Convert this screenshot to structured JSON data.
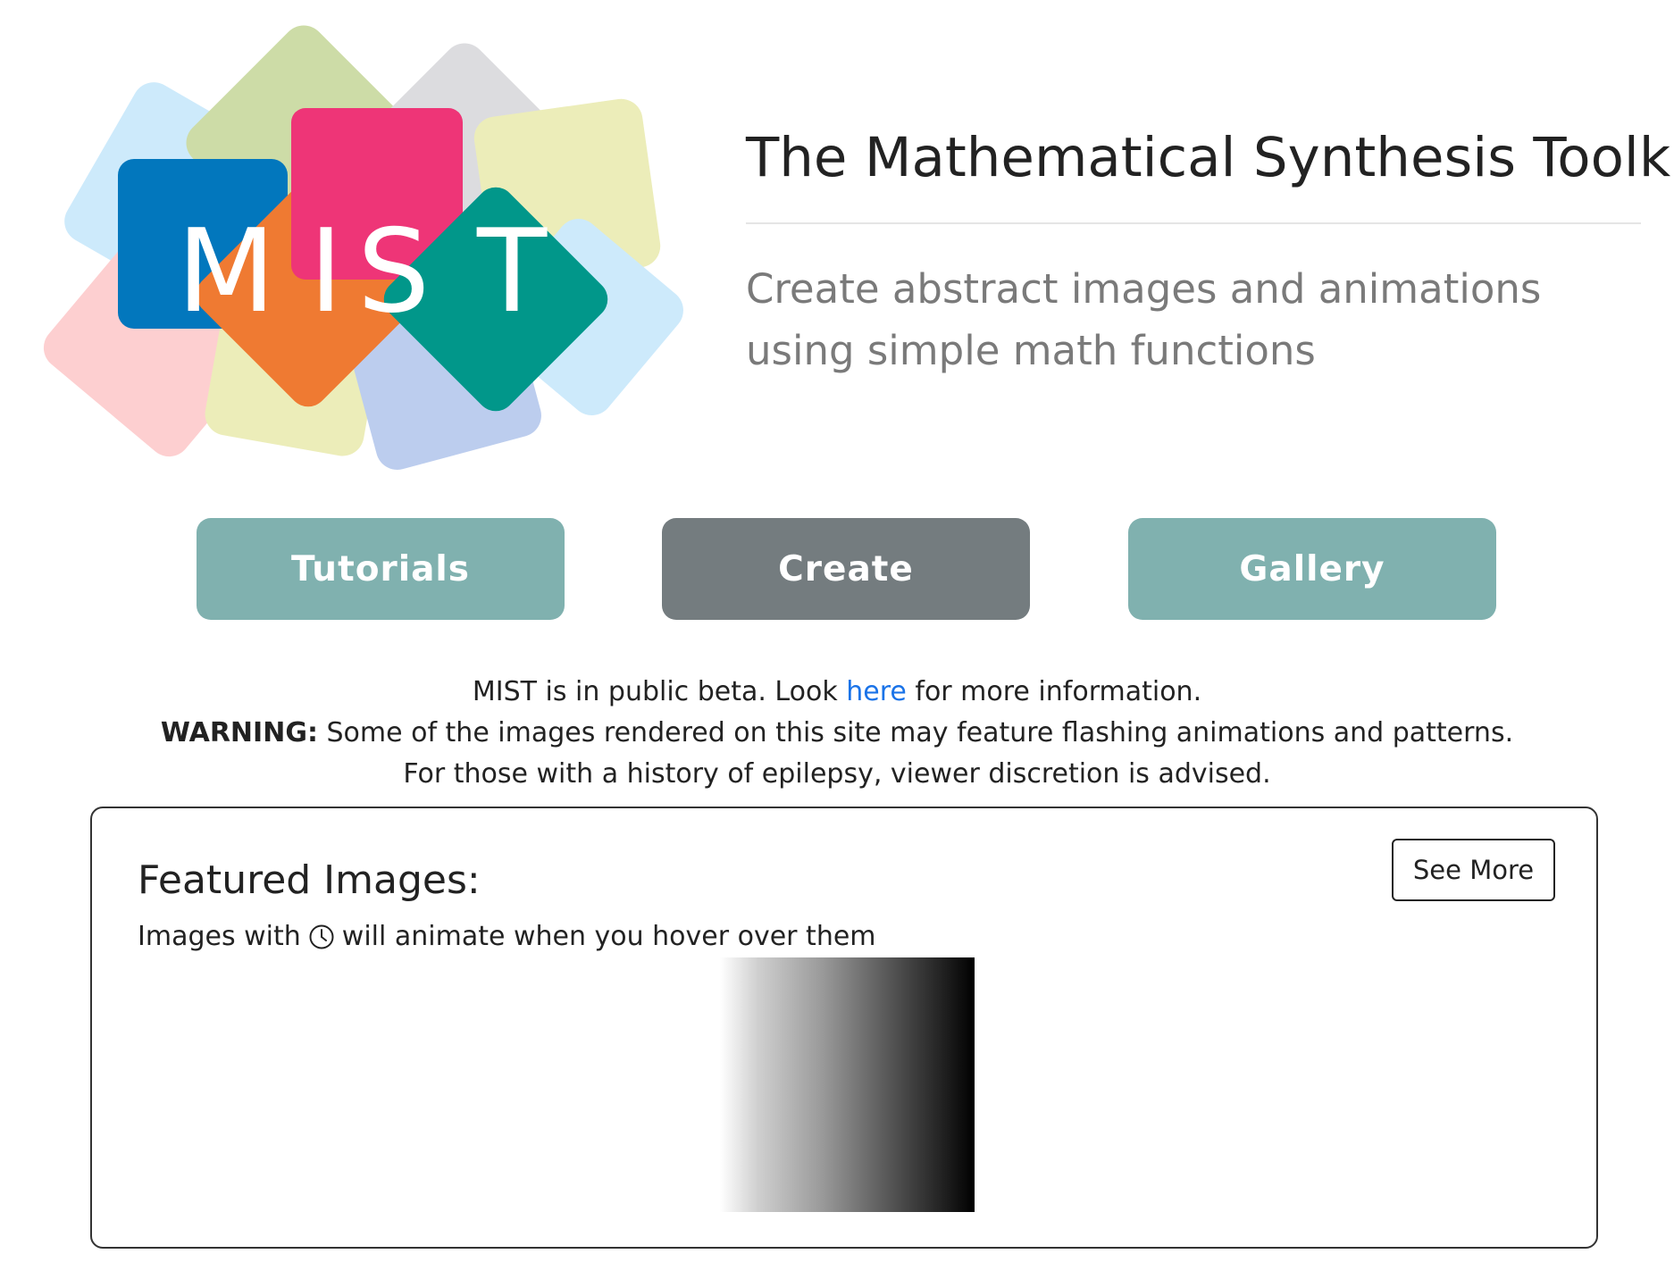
{
  "logo": {
    "text": "MIST",
    "letters": [
      "M",
      "I",
      "S",
      "T"
    ],
    "colors": {
      "blue": "#0277bd",
      "pink": "#ee3577",
      "orange": "#ef7a32",
      "teal": "#01978a",
      "light_blue": "#cdeafb",
      "light_green": "#cddca7",
      "light_gray": "#dcdcdf",
      "light_yellow": "#ecedb9",
      "light_pink": "#fdcfd0",
      "light_periwinkle": "#bccdee"
    }
  },
  "header": {
    "title": "The Mathematical Synthesis Toolkit",
    "subtitle_line1": "Create abstract images and animations",
    "subtitle_line2": "using simple math functions"
  },
  "nav": {
    "tutorials_label": "Tutorials",
    "create_label": "Create",
    "gallery_label": "Gallery",
    "colors": {
      "tutorials": "#80b1af",
      "create": "#747c7f",
      "gallery": "#80b1af"
    }
  },
  "notice": {
    "beta_prefix": "MIST is in public beta. Look ",
    "beta_link": "here",
    "beta_suffix": " for more information.",
    "warning_label": "WARNING:",
    "warning_text": " Some of the images rendered on this site may feature flashing animations and patterns.",
    "epilepsy_text": "For those with a history of epilepsy, viewer discretion is advised.",
    "link_color": "#1a73e8"
  },
  "featured": {
    "heading": "Featured Images:",
    "see_more_label": "See More",
    "hint_prefix": "Images with",
    "hint_icon": "clock-icon",
    "hint_suffix": "will animate when you hover over them"
  }
}
